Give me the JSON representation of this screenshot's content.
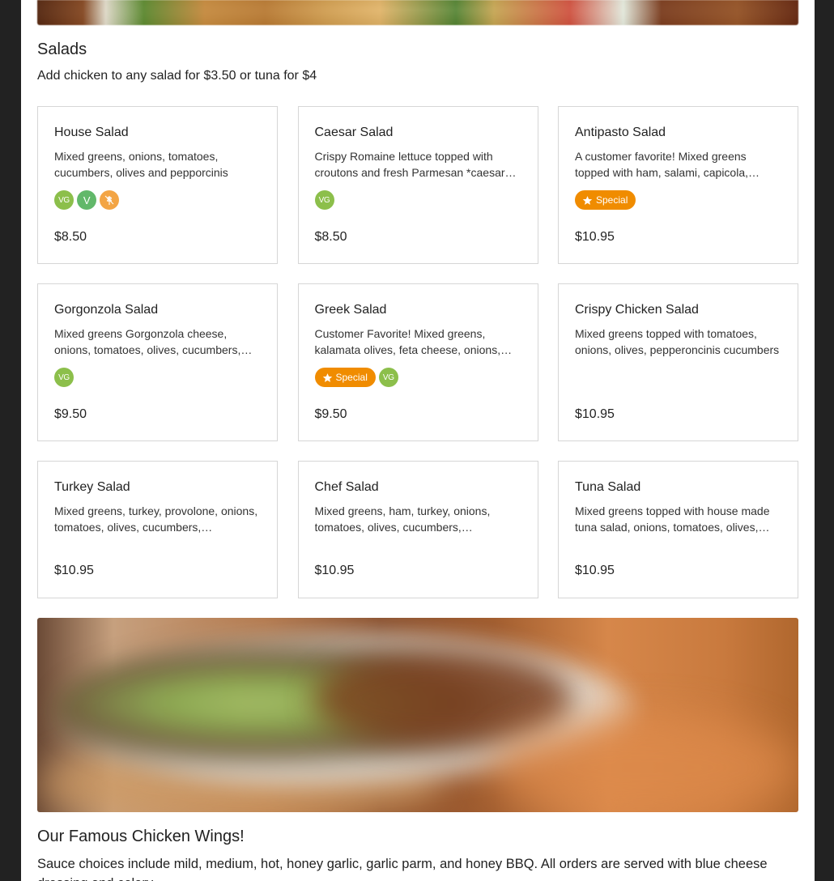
{
  "salads": {
    "title": "Salads",
    "description": "Add chicken to any salad for $3.50 or tuna for $4",
    "items": [
      {
        "name": "House Salad",
        "description": "Mixed greens, onions, tomatoes, cucumbers, olives and pepporcinis",
        "price": "$8.50",
        "badges": [
          "VG",
          "V",
          "GF"
        ]
      },
      {
        "name": "Caesar Salad",
        "description": "Crispy Romaine lettuce topped with croutons and fresh Parmesan *caesar dressing",
        "price": "$8.50",
        "badges": [
          "VG"
        ]
      },
      {
        "name": "Antipasto Salad",
        "description": "A customer favorite! Mixed greens topped with ham, salami, capicola, provolone",
        "price": "$10.95",
        "badges": [
          "Special"
        ]
      },
      {
        "name": "Gorgonzola Salad",
        "description": "Mixed greens Gorgonzola cheese, onions, tomatoes, olives, cucumbers, walnuts",
        "price": "$9.50",
        "badges": [
          "VG"
        ]
      },
      {
        "name": "Greek Salad",
        "description": "Customer Favorite! Mixed greens, kalamata olives, feta cheese, onions, tomatoes",
        "price": "$9.50",
        "badges": [
          "Special",
          "VG"
        ]
      },
      {
        "name": "Crispy Chicken Salad",
        "description": "Mixed greens topped with tomatoes, onions, olives, pepperoncinis cucumbers",
        "price": "$10.95",
        "badges": []
      },
      {
        "name": "Turkey Salad",
        "description": "Mixed greens, turkey, provolone, onions, tomatoes, olives, cucumbers, pepperoncinis",
        "price": "$10.95",
        "badges": []
      },
      {
        "name": "Chef Salad",
        "description": "Mixed greens, ham, turkey, onions, tomatoes, olives, cucumbers, pepperoncinis",
        "price": "$10.95",
        "badges": []
      },
      {
        "name": "Tuna Salad",
        "description": "Mixed greens topped with house made tuna salad, onions, tomatoes, olives, cucumbers",
        "price": "$10.95",
        "badges": []
      }
    ]
  },
  "badge_labels": {
    "VG": "VG",
    "V": "V",
    "GF": "gluten-free-icon",
    "Special": "Special"
  },
  "wings": {
    "title": "Our Famous Chicken Wings!",
    "description": "Sauce choices include mild, medium, hot, honey garlic, garlic parm, and honey BBQ. All orders are served with blue cheese dressing and celery."
  },
  "colors": {
    "vg": "#8cbf4b",
    "v": "#62b86a",
    "gf": "#f3a545",
    "special": "#f08c00"
  }
}
